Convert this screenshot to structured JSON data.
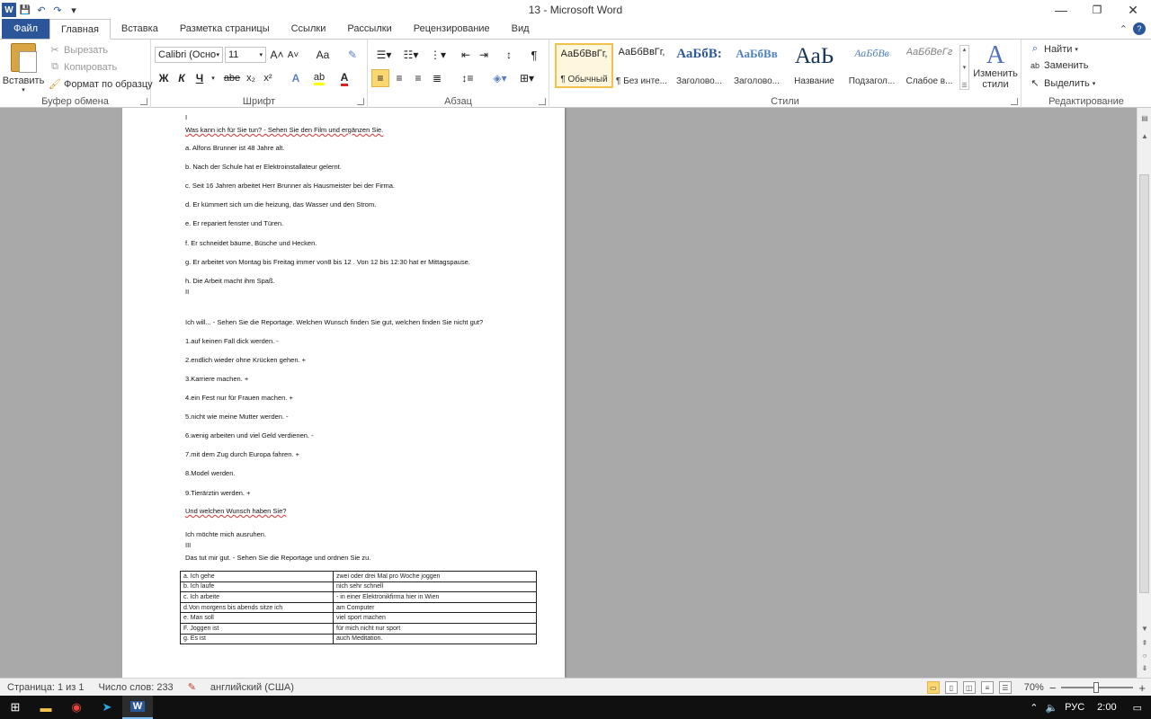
{
  "window": {
    "title": "13  -  Microsoft Word",
    "minimize_glyph": "—",
    "restore_glyph": "❐",
    "close_glyph": "✕"
  },
  "qat": {
    "word_icon": "W",
    "save_icon": "💾",
    "undo_icon": "↶",
    "redo_icon": "↷",
    "customize_icon": "▾"
  },
  "tabs": [
    "Файл",
    "Главная",
    "Вставка",
    "Разметка страницы",
    "Ссылки",
    "Рассылки",
    "Рецензирование",
    "Вид"
  ],
  "ribbon": {
    "clipboard": {
      "label": "Буфер обмена",
      "paste": "Вставить",
      "cut": "Вырезать",
      "copy": "Копировать",
      "format_painter": "Формат по образцу"
    },
    "font": {
      "label": "Шрифт",
      "font_name": "Calibri (Осно",
      "font_size": "11",
      "grow": "A˄",
      "shrink": "A˅",
      "case": "Aa",
      "bold": "Ж",
      "italic": "К",
      "underline": "Ч",
      "strike": "abe",
      "subscript": "x₂",
      "superscript": "x²"
    },
    "paragraph": {
      "label": "Абзац",
      "pilcrow": "¶"
    },
    "styles": {
      "label": "Стили",
      "items": [
        {
          "sample": "АаБбВвГг,",
          "name": "¶ Обычный"
        },
        {
          "sample": "АаБбВвГг,",
          "name": "¶ Без инте..."
        },
        {
          "sample": "АаБбВ:",
          "name": "Заголово..."
        },
        {
          "sample": "АаБбВв",
          "name": "Заголово..."
        },
        {
          "sample": "АаЬ",
          "name": "Название"
        },
        {
          "sample": "АаБбВв",
          "name": "Подзагол..."
        },
        {
          "sample": "АаБбВеГг",
          "name": "Слабое в..."
        }
      ],
      "change_styles": "Изменить стили"
    },
    "editing": {
      "label": "Редактирование",
      "find": "Найти",
      "replace": "Заменить",
      "select": "Выделить"
    }
  },
  "document": {
    "lines": [
      "I",
      "Was kann ich für Sie tun? - Sehen Sie den Film und ergänzen Sie.",
      "a. Alfons Brunner ist 48 Jahre alt.",
      "b. Nach der Schule hat er Elektroinstallateur  gelernt.",
      "c. Seit  16  Jahren arbeitet Herr Brunner als Hausmeister  bei der Firma.",
      "d. Er kümmert sich um die heizung, das Wasser und den Strom.",
      "e. Er repariert fenster und Türen.",
      "f. Er schneidet  bäume, Büsche und Hecken.",
      "g. Er arbeitet von  Montag  bis   Freitag  immer  von8  bis   12 . Von 12  bis 12:30 hat er  Mittagspause.",
      "h. Die Arbeit macht ihm Spaß.",
      "II",
      "Ich will... - Sehen Sie die Reportage. Welchen Wunsch finden Sie gut, welchen finden Sie nicht  gut?",
      "1.auf keinen  Fall dick werden.  -",
      "2.endlich  wieder ohne  Krücken gehen. +",
      "3.Karriere machen.  +",
      "4.ein Fest nur für Frauen machen. +",
      "5.nicht  wie meine Mutter werden. -",
      "6.wenig arbeiten und  viel Geld verdienen. -",
      "7.mit dem Zug durch  Europa fahren. +",
      "8.Model werden.",
      "9.Tierärztin werden. +",
      "Und  welchen  Wunsch  haben Sie?",
      "Ich möchte  mich ausruhen.",
      "III",
      "Das tut mir gut. - Sehen Sie die Reportage und  ordnen Sie zu."
    ],
    "table": [
      [
        "a. Ich gehe",
        "zwei oder  drei Mal pro  Woche joggen"
      ],
      [
        "b. Ich laufe",
        "nich  sehr schnell"
      ],
      [
        "c. Ich arbeite",
        "- in einer  Elektronikfirma hier  in Wien"
      ],
      [
        "d.Von morgens bis abends sitze ich",
        "am Computer"
      ],
      [
        "e. Man soll",
        "viel sport machen"
      ],
      [
        "F. Joggen ist",
        "für mich  nicht  nur sport"
      ],
      [
        "g. Es ist",
        "auch Meditation."
      ]
    ]
  },
  "status": {
    "page": "Страница: 1 из 1",
    "words": "Число слов: 233",
    "language": "английский (США)",
    "zoom": "70%",
    "zoom_minus": "−",
    "zoom_plus": "+"
  },
  "taskbar": {
    "lang": "РУС",
    "time": "2:00"
  }
}
